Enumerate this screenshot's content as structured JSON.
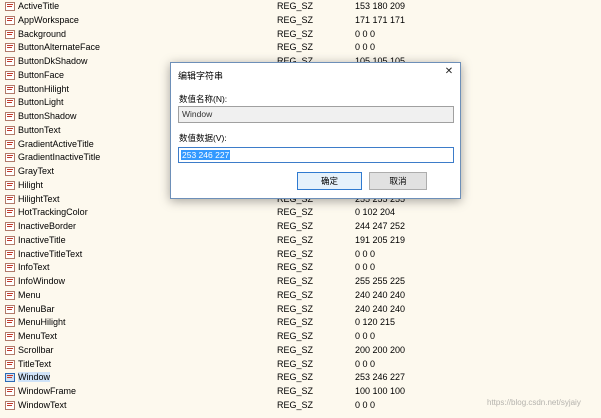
{
  "registry": {
    "rows": [
      {
        "name": "ActiveTitle",
        "type": "REG_SZ",
        "data": "153 180 209"
      },
      {
        "name": "AppWorkspace",
        "type": "REG_SZ",
        "data": "171 171 171"
      },
      {
        "name": "Background",
        "type": "REG_SZ",
        "data": "0 0 0"
      },
      {
        "name": "ButtonAlternateFace",
        "type": "REG_SZ",
        "data": "0 0 0"
      },
      {
        "name": "ButtonDkShadow",
        "type": "REG_SZ",
        "data": "105 105 105"
      },
      {
        "name": "ButtonFace",
        "type": "",
        "data": ""
      },
      {
        "name": "ButtonHilight",
        "type": "",
        "data": ""
      },
      {
        "name": "ButtonLight",
        "type": "",
        "data": ""
      },
      {
        "name": "ButtonShadow",
        "type": "",
        "data": ""
      },
      {
        "name": "ButtonText",
        "type": "",
        "data": ""
      },
      {
        "name": "GradientActiveTitle",
        "type": "",
        "data": ""
      },
      {
        "name": "GradientInactiveTitle",
        "type": "",
        "data": ""
      },
      {
        "name": "GrayText",
        "type": "",
        "data": ""
      },
      {
        "name": "Hilight",
        "type": "",
        "data": ""
      },
      {
        "name": "HilightText",
        "type": "REG_SZ",
        "data": "255 255 255"
      },
      {
        "name": "HotTrackingColor",
        "type": "REG_SZ",
        "data": "0 102 204"
      },
      {
        "name": "InactiveBorder",
        "type": "REG_SZ",
        "data": "244 247 252"
      },
      {
        "name": "InactiveTitle",
        "type": "REG_SZ",
        "data": "191 205 219"
      },
      {
        "name": "InactiveTitleText",
        "type": "REG_SZ",
        "data": "0 0 0"
      },
      {
        "name": "InfoText",
        "type": "REG_SZ",
        "data": "0 0 0"
      },
      {
        "name": "InfoWindow",
        "type": "REG_SZ",
        "data": "255 255 225"
      },
      {
        "name": "Menu",
        "type": "REG_SZ",
        "data": "240 240 240"
      },
      {
        "name": "MenuBar",
        "type": "REG_SZ",
        "data": "240 240 240"
      },
      {
        "name": "MenuHilight",
        "type": "REG_SZ",
        "data": "0 120 215"
      },
      {
        "name": "MenuText",
        "type": "REG_SZ",
        "data": "0 0 0"
      },
      {
        "name": "Scrollbar",
        "type": "REG_SZ",
        "data": "200 200 200"
      },
      {
        "name": "TitleText",
        "type": "REG_SZ",
        "data": "0 0 0"
      },
      {
        "name": "Window",
        "type": "REG_SZ",
        "data": "253 246 227"
      },
      {
        "name": "WindowFrame",
        "type": "REG_SZ",
        "data": "100 100 100"
      },
      {
        "name": "WindowText",
        "type": "REG_SZ",
        "data": "0 0 0"
      }
    ],
    "selected_row": "Window"
  },
  "dialog": {
    "title": "编辑字符串",
    "close_icon": "close-icon",
    "name_label": "数值名称(N):",
    "name_value": "Window",
    "data_label": "数值数据(V):",
    "data_value": "253 246 227",
    "ok_label": "确定",
    "cancel_label": "取消"
  },
  "watermark": "https://blog.csdn.net/syjaiy",
  "colors": {
    "window_background": "#fdf9ee",
    "selection": "#3399ff",
    "ok_border": "#2f7ad0"
  }
}
